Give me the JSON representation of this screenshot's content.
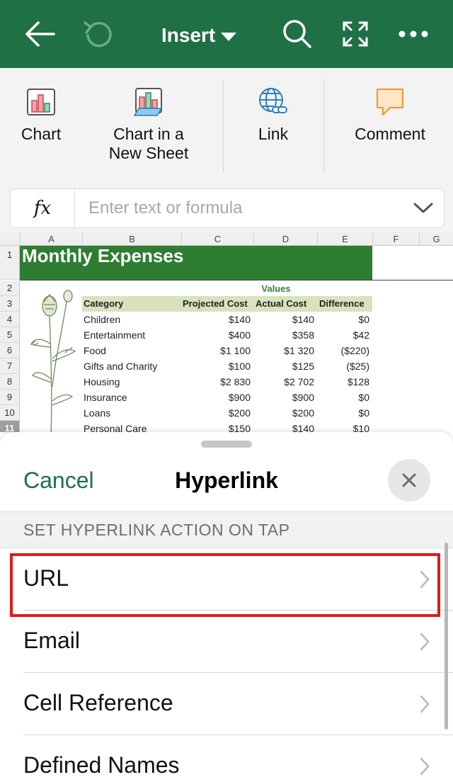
{
  "topbar": {
    "bg": "#1f7145",
    "title": "Insert",
    "icons": [
      "back-arrow-icon",
      "undo-icon",
      "search-icon",
      "fullscreen-icon",
      "more-icon"
    ]
  },
  "ribbon": {
    "items": [
      {
        "label": "Chart",
        "icon": "chart-icon"
      },
      {
        "label": "Chart in a\nNew Sheet",
        "icon": "chart-new-sheet-icon"
      },
      {
        "label": "Link",
        "icon": "link-globe-icon"
      },
      {
        "label": "Comment",
        "icon": "comment-icon"
      }
    ],
    "formula": {
      "fx": "fx",
      "placeholder": "Enter text or formula"
    }
  },
  "sheet": {
    "columns": [
      "A",
      "B",
      "C",
      "D",
      "E",
      "F",
      "G"
    ],
    "rows": [
      "1",
      "2",
      "3",
      "4",
      "5",
      "6",
      "7",
      "8",
      "9",
      "10",
      "11"
    ],
    "title": "Monthly Expenses",
    "values_label": "Values",
    "headers": [
      "Category",
      "Projected Cost",
      "Actual Cost",
      "Difference"
    ],
    "data": [
      [
        "Children",
        "$140",
        "$140",
        "$0"
      ],
      [
        "Entertainment",
        "$400",
        "$358",
        "$42"
      ],
      [
        "Food",
        "$1 100",
        "$1 320",
        "($220)"
      ],
      [
        "Gifts and Charity",
        "$100",
        "$125",
        "($25)"
      ],
      [
        "Housing",
        "$2 830",
        "$2 702",
        "$128"
      ],
      [
        "Insurance",
        "$900",
        "$900",
        "$0"
      ],
      [
        "Loans",
        "$200",
        "$200",
        "$0"
      ],
      [
        "Personal Care",
        "$150",
        "$140",
        "$10"
      ]
    ]
  },
  "panel": {
    "cancel": "Cancel",
    "title": "Hyperlink",
    "section": "SET HYPERLINK ACTION ON TAP",
    "items": [
      "URL",
      "Email",
      "Cell Reference",
      "Defined Names"
    ],
    "highlighted": "URL",
    "highlight_color": "#e0191b"
  }
}
